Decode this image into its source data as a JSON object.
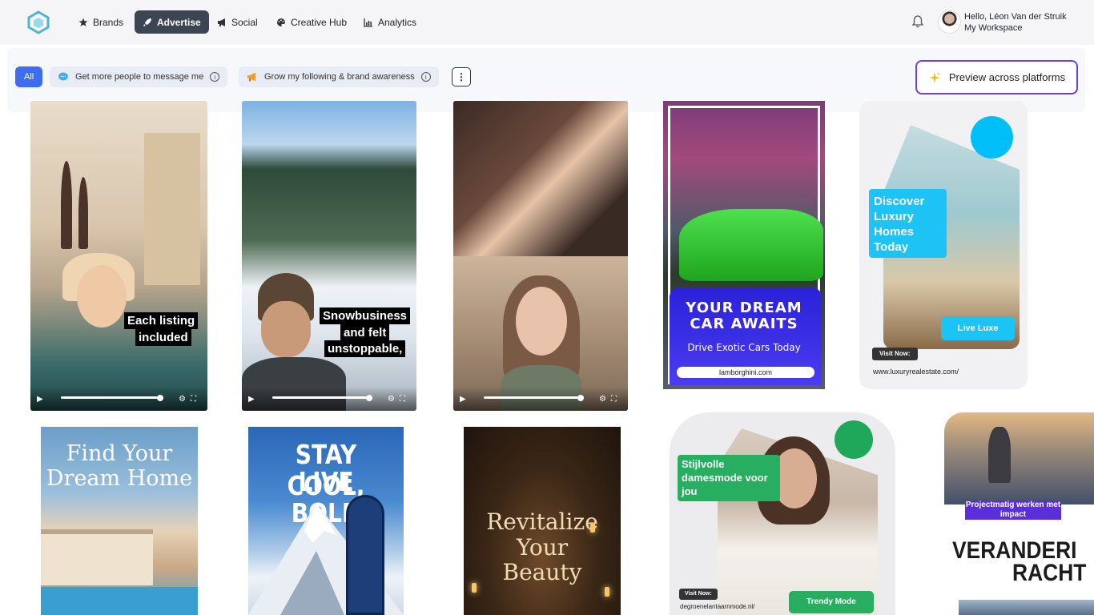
{
  "nav": {
    "items": [
      {
        "label": "Brands",
        "icon": "star-icon"
      },
      {
        "label": "Advertise",
        "icon": "rocket-icon"
      },
      {
        "label": "Social",
        "icon": "megaphone-icon"
      },
      {
        "label": "Creative Hub",
        "icon": "palette-icon"
      },
      {
        "label": "Analytics",
        "icon": "chart-icon"
      }
    ],
    "active": "Advertise"
  },
  "user": {
    "greeting": "Hello, Léon Van der Struik",
    "workspace": "My Workspace"
  },
  "filters": {
    "all": "All",
    "message": "Get more people to message me",
    "awareness": "Grow my following & brand awareness",
    "info_glyph": "i",
    "more_glyph": "⋮"
  },
  "preview_button": "Preview across platforms",
  "ads": {
    "listing_caption_1": "Each listing",
    "listing_caption_2": "included",
    "snow_caption_1": "Snowbusiness",
    "snow_caption_2": "and felt",
    "snow_caption_3": "unstoppable,",
    "car_title_1": "YOUR DREAM",
    "car_title_2": "CAR AWAITS",
    "car_sub": "Drive Exotic Cars Today",
    "car_url": "lamborghini.com",
    "luxury_title": "Discover Luxury Homes Today",
    "luxury_cta": "Live Luxe",
    "luxury_visit": "Visit Now:",
    "luxury_url": "www.luxuryrealestate.com/",
    "home_title_1": "Find Your",
    "home_title_2": "Dream Home",
    "cool_title_1": "STAY COOL,",
    "cool_title_2": "LIVE BOLD",
    "beauty_title_1": "Revitalize",
    "beauty_title_2": "Your",
    "beauty_title_3": "Beauty",
    "fashion_title": "Stijlvolle damesmode voor jou",
    "fashion_cta": "Trendy Mode",
    "fashion_visit": "Visit Now:",
    "fashion_url": "degroenelantaarnmode.nl/",
    "project_tag": "Projectmatig werken met impact",
    "project_title_1": "VERANDERI",
    "project_title_2": "RACHT"
  },
  "colors": {
    "accent": "#3e6df0",
    "preview_border": "#6b3fe0",
    "luxury_blue": "#1ec3f5",
    "fashion_green": "#27ae60"
  }
}
